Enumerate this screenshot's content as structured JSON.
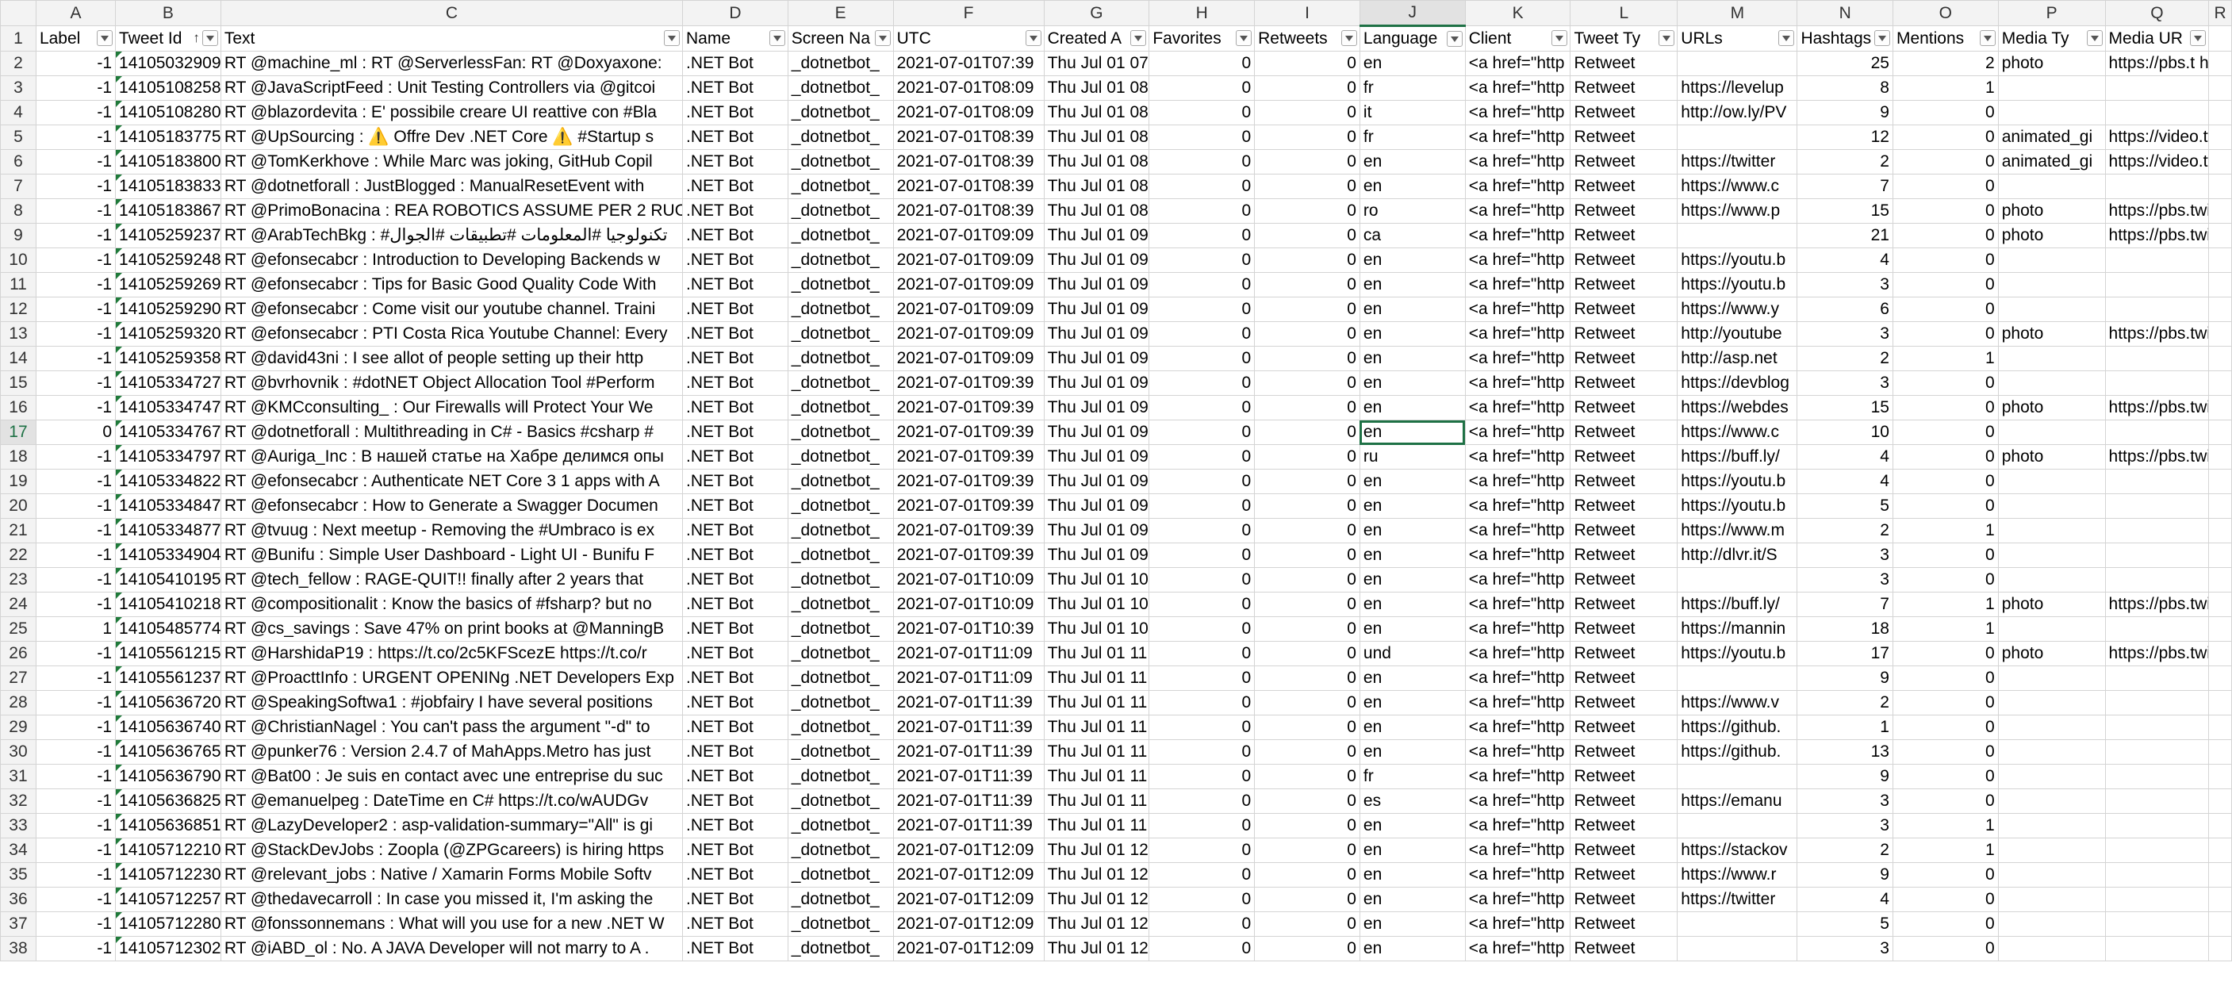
{
  "columns": [
    "A",
    "B",
    "C",
    "D",
    "E",
    "F",
    "G",
    "H",
    "I",
    "J",
    "K",
    "L",
    "M",
    "N",
    "O",
    "P",
    "Q",
    "R"
  ],
  "headers": [
    "Label",
    "Tweet Id",
    "Text",
    "Name",
    "Screen Na",
    "UTC",
    "Created A",
    "Favorites",
    "Retweets",
    "Language",
    "Client",
    "Tweet Ty",
    "URLs",
    "Hashtags",
    "Mentions",
    "Media Ty",
    "Media UR",
    ""
  ],
  "rows": [
    [
      "-1",
      "14105032909",
      "RT @machine_ml : RT @ServerlessFan: RT @Doxyaxone:",
      ".NET Bot",
      "_dotnetbot_",
      "2021-07-01T07:39",
      "Thu Jul 01 07",
      "0",
      "0",
      "en",
      "<a href=\"http",
      "Retweet",
      "",
      "25",
      "2",
      "photo",
      "https://pbs.t https://"
    ],
    [
      "-1",
      "14105108258",
      "RT @JavaScriptFeed : Unit Testing Controllers via @gitcoi",
      ".NET Bot",
      "_dotnetbot_",
      "2021-07-01T08:09",
      "Thu Jul 01 08",
      "0",
      "0",
      "fr",
      "<a href=\"http",
      "Retweet",
      "https://levelup",
      "8",
      "1",
      "",
      ""
    ],
    [
      "-1",
      "14105108280",
      "RT @blazordevita : E' possibile creare UI reattive con #Bla",
      ".NET Bot",
      "_dotnetbot_",
      "2021-07-01T08:09",
      "Thu Jul 01 08",
      "0",
      "0",
      "it",
      "<a href=\"http",
      "Retweet",
      "http://ow.ly/PV",
      "9",
      "0",
      "",
      ""
    ],
    [
      "-1",
      "14105183775",
      "RT @UpSourcing : ⚠️ Offre Dev .NET Core ⚠️ #Startup s",
      ".NET Bot",
      "_dotnetbot_",
      "2021-07-01T08:39",
      "Thu Jul 01 08",
      "0",
      "0",
      "fr",
      "<a href=\"http",
      "Retweet",
      "",
      "12",
      "0",
      "animated_gi",
      "https://video.twimg."
    ],
    [
      "-1",
      "14105183800",
      "RT @TomKerkhove : While Marc was joking, GitHub Copil",
      ".NET Bot",
      "_dotnetbot_",
      "2021-07-01T08:39",
      "Thu Jul 01 08",
      "0",
      "0",
      "en",
      "<a href=\"http",
      "Retweet",
      "https://twitter",
      "2",
      "0",
      "animated_gi",
      "https://video.twimg."
    ],
    [
      "-1",
      "14105183833",
      "RT @dotnetforall : JustBlogged : ManualResetEvent with",
      ".NET Bot",
      "_dotnetbot_",
      "2021-07-01T08:39",
      "Thu Jul 01 08",
      "0",
      "0",
      "en",
      "<a href=\"http",
      "Retweet",
      "https://www.c",
      "7",
      "0",
      "",
      ""
    ],
    [
      "-1",
      "14105183867",
      "RT @PrimoBonacina : REA ROBOTICS ASSUME PER 2 RUO",
      ".NET Bot",
      "_dotnetbot_",
      "2021-07-01T08:39",
      "Thu Jul 01 08",
      "0",
      "0",
      "ro",
      "<a href=\"http",
      "Retweet",
      "https://www.p",
      "15",
      "0",
      "photo",
      "https://pbs.twimg.co"
    ],
    [
      "-1",
      "14105259237",
      "RT @ArabTechBkg : #تكنولوجيا #المعلومات #تطبيقات #الجوال",
      ".NET Bot",
      "_dotnetbot_",
      "2021-07-01T09:09",
      "Thu Jul 01 09",
      "0",
      "0",
      "ca",
      "<a href=\"http",
      "Retweet",
      "",
      "21",
      "0",
      "photo",
      "https://pbs.twimg.co"
    ],
    [
      "-1",
      "14105259248",
      "RT @efonsecabcr : Introduction to Developing Backends w",
      ".NET Bot",
      "_dotnetbot_",
      "2021-07-01T09:09",
      "Thu Jul 01 09",
      "0",
      "0",
      "en",
      "<a href=\"http",
      "Retweet",
      "https://youtu.b",
      "4",
      "0",
      "",
      ""
    ],
    [
      "-1",
      "14105259269",
      "RT @efonsecabcr : Tips for Basic Good Quality Code With",
      ".NET Bot",
      "_dotnetbot_",
      "2021-07-01T09:09",
      "Thu Jul 01 09",
      "0",
      "0",
      "en",
      "<a href=\"http",
      "Retweet",
      "https://youtu.b",
      "3",
      "0",
      "",
      ""
    ],
    [
      "-1",
      "14105259290",
      "RT @efonsecabcr : Come visit our youtube channel. Traini",
      ".NET Bot",
      "_dotnetbot_",
      "2021-07-01T09:09",
      "Thu Jul 01 09",
      "0",
      "0",
      "en",
      "<a href=\"http",
      "Retweet",
      "https://www.y",
      "6",
      "0",
      "",
      ""
    ],
    [
      "-1",
      "14105259320",
      "RT @efonsecabcr : PTI Costa Rica Youtube Channel: Every",
      ".NET Bot",
      "_dotnetbot_",
      "2021-07-01T09:09",
      "Thu Jul 01 09",
      "0",
      "0",
      "en",
      "<a href=\"http",
      "Retweet",
      "http://youtube",
      "3",
      "0",
      "photo",
      "https://pbs.twimg.co"
    ],
    [
      "-1",
      "14105259358",
      "RT @david43ni : I see allot of people setting up their http",
      ".NET Bot",
      "_dotnetbot_",
      "2021-07-01T09:09",
      "Thu Jul 01 09",
      "0",
      "0",
      "en",
      "<a href=\"http",
      "Retweet",
      "http://asp.net",
      "2",
      "1",
      "",
      ""
    ],
    [
      "-1",
      "14105334727",
      "RT @bvrhovnik : #dotNET Object Allocation Tool #Perform",
      ".NET Bot",
      "_dotnetbot_",
      "2021-07-01T09:39",
      "Thu Jul 01 09",
      "0",
      "0",
      "en",
      "<a href=\"http",
      "Retweet",
      "https://devblog",
      "3",
      "0",
      "",
      ""
    ],
    [
      "-1",
      "14105334747",
      "RT @KMCconsulting_ : Our Firewalls will Protect Your We",
      ".NET Bot",
      "_dotnetbot_",
      "2021-07-01T09:39",
      "Thu Jul 01 09",
      "0",
      "0",
      "en",
      "<a href=\"http",
      "Retweet",
      "https://webdes",
      "15",
      "0",
      "photo",
      "https://pbs.twimg.co"
    ],
    [
      "0",
      "14105334767",
      "RT @dotnetforall : Multithreading in C# - Basics #csharp #",
      ".NET Bot",
      "_dotnetbot_",
      "2021-07-01T09:39",
      "Thu Jul 01 09",
      "0",
      "0",
      "en",
      "<a href=\"http",
      "Retweet",
      "https://www.c",
      "10",
      "0",
      "",
      ""
    ],
    [
      "-1",
      "14105334797",
      "RT @Auriga_Inc : В нашей статье на Хабре делимся опы",
      ".NET Bot",
      "_dotnetbot_",
      "2021-07-01T09:39",
      "Thu Jul 01 09",
      "0",
      "0",
      "ru",
      "<a href=\"http",
      "Retweet",
      "https://buff.ly/",
      "4",
      "0",
      "photo",
      "https://pbs.twimg.co"
    ],
    [
      "-1",
      "14105334822",
      "RT @efonsecabcr : Authenticate NET Core 3 1 apps with A",
      ".NET Bot",
      "_dotnetbot_",
      "2021-07-01T09:39",
      "Thu Jul 01 09",
      "0",
      "0",
      "en",
      "<a href=\"http",
      "Retweet",
      "https://youtu.b",
      "4",
      "0",
      "",
      ""
    ],
    [
      "-1",
      "14105334847",
      "RT @efonsecabcr : How to Generate a Swagger Documen",
      ".NET Bot",
      "_dotnetbot_",
      "2021-07-01T09:39",
      "Thu Jul 01 09",
      "0",
      "0",
      "en",
      "<a href=\"http",
      "Retweet",
      "https://youtu.b",
      "5",
      "0",
      "",
      ""
    ],
    [
      "-1",
      "14105334877",
      "RT @tvuug : Next meetup - Removing the #Umbraco is ex",
      ".NET Bot",
      "_dotnetbot_",
      "2021-07-01T09:39",
      "Thu Jul 01 09",
      "0",
      "0",
      "en",
      "<a href=\"http",
      "Retweet",
      "https://www.m",
      "2",
      "1",
      "",
      ""
    ],
    [
      "-1",
      "14105334904",
      "RT @Bunifu : Simple User Dashboard - Light UI - Bunifu F",
      ".NET Bot",
      "_dotnetbot_",
      "2021-07-01T09:39",
      "Thu Jul 01 09",
      "0",
      "0",
      "en",
      "<a href=\"http",
      "Retweet",
      "http://dlvr.it/S",
      "3",
      "0",
      "",
      ""
    ],
    [
      "-1",
      "14105410195",
      "RT @tech_fellow : RAGE-QUIT!! finally after 2 years that",
      ".NET Bot",
      "_dotnetbot_",
      "2021-07-01T10:09",
      "Thu Jul 01 10",
      "0",
      "0",
      "en",
      "<a href=\"http",
      "Retweet",
      "",
      "3",
      "0",
      "",
      ""
    ],
    [
      "-1",
      "14105410218",
      "RT @compositionalit : Know the basics of #fsharp? but no",
      ".NET Bot",
      "_dotnetbot_",
      "2021-07-01T10:09",
      "Thu Jul 01 10",
      "0",
      "0",
      "en",
      "<a href=\"http",
      "Retweet",
      "https://buff.ly/",
      "7",
      "1",
      "photo",
      "https://pbs.twimg.co"
    ],
    [
      "1",
      "14105485774",
      "RT @cs_savings : Save 47% on print books at @ManningB",
      ".NET Bot",
      "_dotnetbot_",
      "2021-07-01T10:39",
      "Thu Jul 01 10",
      "0",
      "0",
      "en",
      "<a href=\"http",
      "Retweet",
      "https://mannin",
      "18",
      "1",
      "",
      ""
    ],
    [
      "-1",
      "14105561215",
      "RT @HarshidaP19 : https://t.co/2c5KFScezE https://t.co/r",
      ".NET Bot",
      "_dotnetbot_",
      "2021-07-01T11:09",
      "Thu Jul 01 11",
      "0",
      "0",
      "und",
      "<a href=\"http",
      "Retweet",
      "https://youtu.b",
      "17",
      "0",
      "photo",
      "https://pbs.twimg.co"
    ],
    [
      "-1",
      "14105561237",
      "RT @ProacttInfo : URGENT OPENINg .NET Developers Exp",
      ".NET Bot",
      "_dotnetbot_",
      "2021-07-01T11:09",
      "Thu Jul 01 11",
      "0",
      "0",
      "en",
      "<a href=\"http",
      "Retweet",
      "",
      "9",
      "0",
      "",
      ""
    ],
    [
      "-1",
      "14105636720",
      "RT @SpeakingSoftwa1 : #jobfairy I have several positions",
      ".NET Bot",
      "_dotnetbot_",
      "2021-07-01T11:39",
      "Thu Jul 01 11",
      "0",
      "0",
      "en",
      "<a href=\"http",
      "Retweet",
      "https://www.v",
      "2",
      "0",
      "",
      ""
    ],
    [
      "-1",
      "14105636740",
      "RT @ChristianNagel : You can't pass the argument \"-d\" to",
      ".NET Bot",
      "_dotnetbot_",
      "2021-07-01T11:39",
      "Thu Jul 01 11",
      "0",
      "0",
      "en",
      "<a href=\"http",
      "Retweet",
      "https://github.",
      "1",
      "0",
      "",
      ""
    ],
    [
      "-1",
      "14105636765",
      "RT @punker76 : Version 2.4.7 of MahApps.Metro has just",
      ".NET Bot",
      "_dotnetbot_",
      "2021-07-01T11:39",
      "Thu Jul 01 11",
      "0",
      "0",
      "en",
      "<a href=\"http",
      "Retweet",
      "https://github.",
      "13",
      "0",
      "",
      ""
    ],
    [
      "-1",
      "14105636790",
      "RT @Bat00 : Je suis en contact avec une entreprise du suc",
      ".NET Bot",
      "_dotnetbot_",
      "2021-07-01T11:39",
      "Thu Jul 01 11",
      "0",
      "0",
      "fr",
      "<a href=\"http",
      "Retweet",
      "",
      "9",
      "0",
      "",
      ""
    ],
    [
      "-1",
      "14105636825",
      "RT @emanuelpeg : DateTime en C# https://t.co/wAUDGv",
      ".NET Bot",
      "_dotnetbot_",
      "2021-07-01T11:39",
      "Thu Jul 01 11",
      "0",
      "0",
      "es",
      "<a href=\"http",
      "Retweet",
      "https://emanu",
      "3",
      "0",
      "",
      ""
    ],
    [
      "-1",
      "14105636851",
      "RT @LazyDeveloper2 : asp-validation-summary=\"All\" is gi",
      ".NET Bot",
      "_dotnetbot_",
      "2021-07-01T11:39",
      "Thu Jul 01 11",
      "0",
      "0",
      "en",
      "<a href=\"http",
      "Retweet",
      "",
      "3",
      "1",
      "",
      ""
    ],
    [
      "-1",
      "14105712210",
      "RT @StackDevJobs : Zoopla (@ZPGcareers) is hiring https",
      ".NET Bot",
      "_dotnetbot_",
      "2021-07-01T12:09",
      "Thu Jul 01 12",
      "0",
      "0",
      "en",
      "<a href=\"http",
      "Retweet",
      "https://stackov",
      "2",
      "1",
      "",
      ""
    ],
    [
      "-1",
      "14105712230",
      "RT @relevant_jobs : Native / Xamarin Forms Mobile Softv",
      ".NET Bot",
      "_dotnetbot_",
      "2021-07-01T12:09",
      "Thu Jul 01 12",
      "0",
      "0",
      "en",
      "<a href=\"http",
      "Retweet",
      "https://www.r",
      "9",
      "0",
      "",
      ""
    ],
    [
      "-1",
      "14105712257",
      "RT @thedavecarroll : In case you missed it, I'm asking the",
      ".NET Bot",
      "_dotnetbot_",
      "2021-07-01T12:09",
      "Thu Jul 01 12",
      "0",
      "0",
      "en",
      "<a href=\"http",
      "Retweet",
      "https://twitter",
      "4",
      "0",
      "",
      ""
    ],
    [
      "-1",
      "14105712280",
      "RT @fonssonnemans : What will you use for a new .NET W",
      ".NET Bot",
      "_dotnetbot_",
      "2021-07-01T12:09",
      "Thu Jul 01 12",
      "0",
      "0",
      "en",
      "<a href=\"http",
      "Retweet",
      "",
      "5",
      "0",
      "",
      ""
    ],
    [
      "-1",
      "14105712302",
      "RT @iABD_ol : No. A JAVA Developer will not marry to A .",
      ".NET Bot",
      "_dotnetbot_",
      "2021-07-01T12:09",
      "Thu Jul 01 12",
      "0",
      "0",
      "en",
      "<a href=\"http",
      "Retweet",
      "",
      "3",
      "0",
      "",
      ""
    ]
  ],
  "selection": {
    "row": 16,
    "col": "J"
  }
}
